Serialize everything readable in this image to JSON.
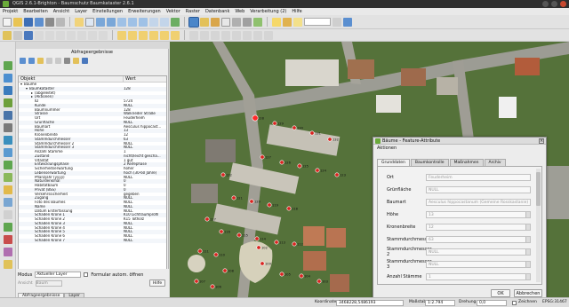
{
  "window": {
    "title": "QGIS 2.6.1-Brighton - Baumschutz Baumkataster 2.6.1"
  },
  "menu": [
    "Projekt",
    "Bearbeiten",
    "Ansicht",
    "Layer",
    "Einstellungen",
    "Erweiterungen",
    "Vektor",
    "Raster",
    "Datenbank",
    "Web",
    "Verarbeitung (2)",
    "Hilfe"
  ],
  "panel": {
    "title": "Abfrageergebnisse",
    "columns": {
      "object": "Objekt",
      "value": "Wert"
    },
    "rows": [
      {
        "label": "Bäume",
        "value": "",
        "indent": 0,
        "expander": "▾"
      },
      {
        "label": "Baumkataster",
        "value": "128",
        "indent": 1,
        "expander": "▾"
      },
      {
        "label": "(abgeleitet)",
        "value": "",
        "indent": 2,
        "expander": "▸"
      },
      {
        "label": "(Aktionen)",
        "value": "",
        "indent": 2,
        "expander": "▸"
      },
      {
        "label": "ID",
        "value": "5724",
        "indent": 2,
        "expander": ""
      },
      {
        "label": "Kunde",
        "value": "NULL",
        "indent": 2,
        "expander": ""
      },
      {
        "label": "Baumnummer",
        "value": "128",
        "indent": 2,
        "expander": ""
      },
      {
        "label": "Strasse",
        "value": "Walkrieder Straße",
        "indent": 2,
        "expander": ""
      },
      {
        "label": "Ort",
        "value": "Feuderheim",
        "indent": 2,
        "expander": ""
      },
      {
        "label": "Grünfläche",
        "value": "NULL",
        "indent": 2,
        "expander": ""
      },
      {
        "label": "Baumart",
        "value": "Aesculus hippocast...",
        "indent": 2,
        "expander": ""
      },
      {
        "label": "Höhe",
        "value": "13",
        "indent": 2,
        "expander": ""
      },
      {
        "label": "Kronenbreite",
        "value": "12",
        "indent": 2,
        "expander": ""
      },
      {
        "label": "Stammdurchmesser",
        "value": "63",
        "indent": 2,
        "expander": ""
      },
      {
        "label": "Stammdurchmesser 2",
        "value": "NULL",
        "indent": 2,
        "expander": ""
      },
      {
        "label": "Stammdurchmesser 3",
        "value": "NULL",
        "indent": 2,
        "expander": ""
      },
      {
        "label": "Anzahl Stämme",
        "value": "1",
        "indent": 2,
        "expander": ""
      },
      {
        "label": "Zustand",
        "value": "nicht/leicht geschä...",
        "indent": 2,
        "expander": ""
      },
      {
        "label": "Vitalität",
        "value": "1 gut",
        "indent": 2,
        "expander": ""
      },
      {
        "label": "Entwicklungsphase",
        "value": "2 Reifephase",
        "indent": 2,
        "expander": ""
      },
      {
        "label": "Sicherheitserwartung",
        "value": "höher",
        "indent": 2,
        "expander": ""
      },
      {
        "label": "Lebenserwartung",
        "value": "hoch (30-60 Jahre)",
        "indent": 2,
        "expander": ""
      },
      {
        "label": "Pflanzjahr (yyyy)",
        "value": "NULL",
        "indent": 2,
        "expander": ""
      },
      {
        "label": "Naturdenkmal",
        "value": "0",
        "indent": 2,
        "expander": ""
      },
      {
        "label": "Habitatbaum",
        "value": "0",
        "indent": 2,
        "expander": ""
      },
      {
        "label": "Privat (BSS)",
        "value": "0",
        "indent": 2,
        "expander": ""
      },
      {
        "label": "Verkehrssicherheit",
        "value": "gegeben",
        "indent": 2,
        "expander": ""
      },
      {
        "label": "Zugang",
        "value": "NULL",
        "indent": 2,
        "expander": ""
      },
      {
        "label": "Foto des Baumes",
        "value": "NULL",
        "indent": 2,
        "expander": ""
      },
      {
        "label": "Name",
        "value": "NULL",
        "indent": 2,
        "expander": ""
      },
      {
        "label": "Datum Ersterfassung",
        "value": "NULL",
        "indent": 2,
        "expander": ""
      },
      {
        "label": "Schaden Krone 1",
        "value": "K10 Lichtraumprofil",
        "indent": 2,
        "expander": ""
      },
      {
        "label": "Schaden Krone 2",
        "value": "K15 Totholz",
        "indent": 2,
        "expander": ""
      },
      {
        "label": "Schaden Krone 3",
        "value": "NULL",
        "indent": 2,
        "expander": ""
      },
      {
        "label": "Schaden Krone 4",
        "value": "NULL",
        "indent": 2,
        "expander": ""
      },
      {
        "label": "Schaden Krone 5",
        "value": "NULL",
        "indent": 2,
        "expander": ""
      },
      {
        "label": "Schaden Krone 6",
        "value": "NULL",
        "indent": 2,
        "expander": ""
      },
      {
        "label": "Schaden Krone 7",
        "value": "NULL",
        "indent": 2,
        "expander": ""
      }
    ],
    "modus_label": "Modus",
    "modus_value": "Aktueller Layer",
    "auto_open_label": "Formular autom. öffnen",
    "ansicht_label": "Ansicht",
    "ansicht_value": "Baum",
    "help_button": "Hilfe",
    "tabs": [
      "Abfrageergebnisse",
      "Layer"
    ]
  },
  "dialog": {
    "title": "Bäume - Feature-Attribute",
    "aktionen_label": "Aktionen",
    "tabs": [
      "Grunddaten",
      "Baumkontrolle",
      "Maßnahmen",
      "Archiv"
    ],
    "active_tab": 0,
    "fields": [
      {
        "label": "Ort",
        "value": "Feuderheim"
      },
      {
        "label": "Grünfläche",
        "value": "NULL"
      },
      {
        "label": "Baumart",
        "value": "Aesculus hippocastanum (Gemeine Rosskastanie)"
      },
      {
        "label": "Höhe",
        "value": "13"
      },
      {
        "label": "Kronenbreite",
        "value": "12"
      },
      {
        "label": "Stammdurchmesser",
        "value": "63"
      },
      {
        "label": "Stammdurchmesser 2",
        "value": "NULL"
      },
      {
        "label": "Stammdurchmesser 3",
        "value": "NULL"
      },
      {
        "label": "Anzahl Stämme",
        "value": "1"
      }
    ],
    "ok_button": "OK",
    "cancel_button": "Abbrechen"
  },
  "statusbar": {
    "coord_label": "Koordinate:",
    "coord_value": "3468228,5486193",
    "scale_label": "Maßstab",
    "scale_value": "1:2.794",
    "rotation_label": "Drehung:",
    "rotation_value": "0,0",
    "render_label": "Zeichnen",
    "crs": "EPSG:31467"
  },
  "map": {
    "tree_labels": [
      "128",
      "129",
      "130",
      "131",
      "132",
      "127",
      "126",
      "125",
      "124",
      "123",
      "122",
      "121",
      "120",
      "119",
      "118",
      "117",
      "116",
      "115",
      "114",
      "113",
      "112",
      "111",
      "110",
      "109",
      "108",
      "107",
      "106",
      "105",
      "104",
      "103",
      "102"
    ]
  },
  "colors": {
    "tree_marker": "#d9231f",
    "selected_marker": "#ff2a2a",
    "accent": "#6aaa3a",
    "title_bar": "#2f2f2f"
  }
}
